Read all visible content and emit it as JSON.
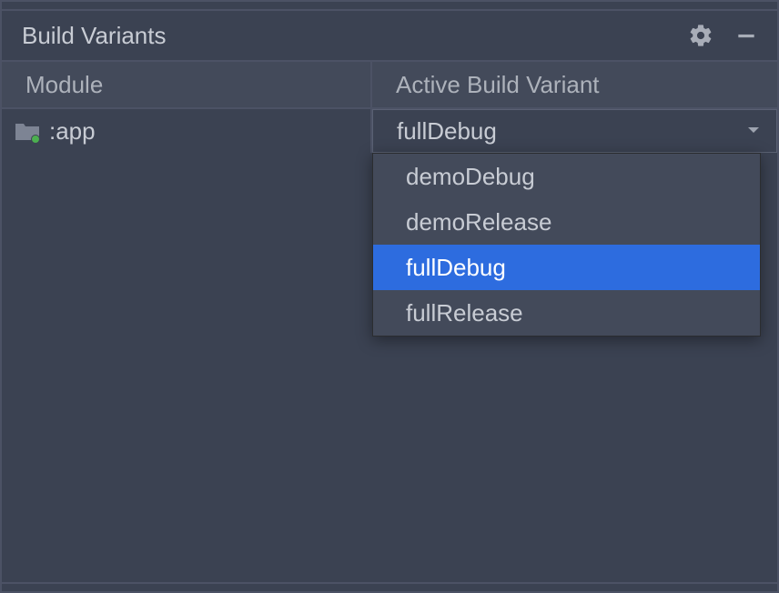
{
  "panel": {
    "title": "Build Variants"
  },
  "table": {
    "headers": {
      "module": "Module",
      "variant": "Active Build Variant"
    },
    "rows": [
      {
        "module": ":app",
        "selected_variant": "fullDebug"
      }
    ]
  },
  "dropdown": {
    "options": [
      {
        "label": "demoDebug",
        "selected": false
      },
      {
        "label": "demoRelease",
        "selected": false
      },
      {
        "label": "fullDebug",
        "selected": true
      },
      {
        "label": "fullRelease",
        "selected": false
      }
    ]
  }
}
